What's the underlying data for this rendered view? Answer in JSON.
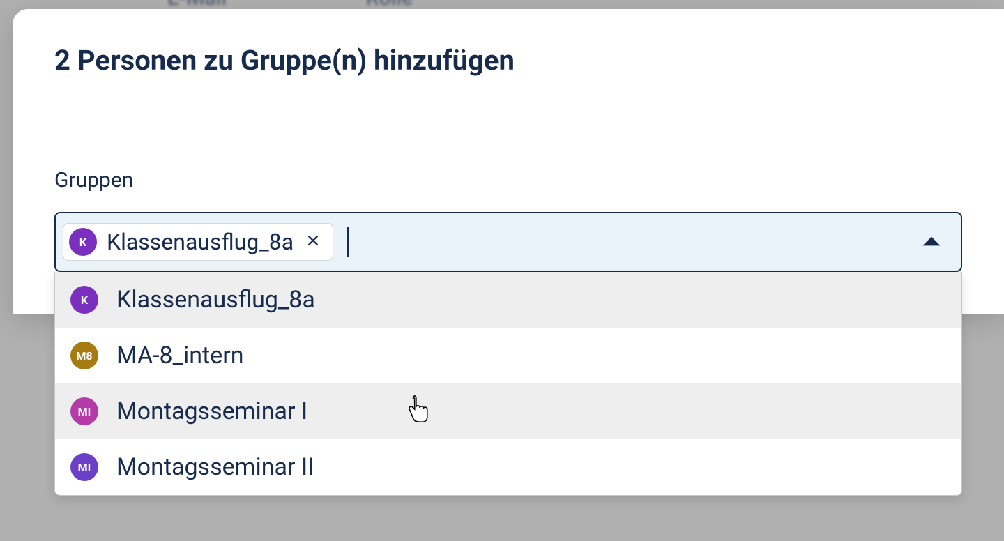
{
  "background_headers": [
    "",
    "E-Mail",
    "Rolle",
    ""
  ],
  "modal": {
    "title": "2 Personen zu Gruppe(n) hinzufügen",
    "field_label": "Gruppen",
    "selected": [
      {
        "initials": "K",
        "label": "Klassenausflug_8a",
        "color": "#7b2fbf"
      }
    ],
    "options": [
      {
        "initials": "K",
        "label": "Klassenausflug_8a",
        "color": "#7b2fbf",
        "highlighted": true
      },
      {
        "initials": "M8",
        "label": "MA-8_intern",
        "color": "#a67b12",
        "highlighted": false
      },
      {
        "initials": "MI",
        "label": "Montagsseminar I",
        "color": "#b43aa7",
        "highlighted": true
      },
      {
        "initials": "MI",
        "label": "Montagsseminar II",
        "color": "#6b3fc6",
        "highlighted": false
      }
    ]
  }
}
